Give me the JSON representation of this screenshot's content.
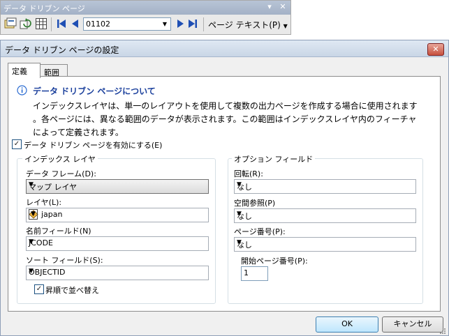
{
  "toolbar": {
    "title": "データ ドリブン ページ",
    "page_value": "01102",
    "page_text_label": "ページ テキスト(P)",
    "icons": [
      "setup-icon",
      "refresh-icon",
      "table-icon",
      "first-page-icon",
      "previous-page-icon",
      "next-page-icon",
      "last-page-icon"
    ]
  },
  "dialog": {
    "title": "データ ドリブン ページの設定",
    "tabs": [
      "定義",
      "範囲"
    ],
    "about_heading": "データ ドリブン ページについて",
    "about_line1": "インデックスレイヤは、単一のレイアウトを使用して複数の出力ページを作成する場合に使用されます",
    "about_line2": "。各ページには、異なる範囲のデータが表示されます。この範囲はインデックスレイヤ内のフィーチャ",
    "about_line3": "によって定義されます。",
    "enable_label": "データ ドリブン ページを有効にする(E)",
    "enable_checked": true,
    "index_group": {
      "title": "インデックス レイヤ",
      "data_frame_label": "データ フレーム(D):",
      "data_frame_value": "マップ レイヤ",
      "layer_label": "レイヤ(L):",
      "layer_value": "japan",
      "name_field_label": "名前フィールド(N)",
      "name_field_value": "JCODE",
      "sort_field_label": "ソート フィールド(S):",
      "sort_field_value": "OBJECTID",
      "ascending_label": "昇順で並べ替え",
      "ascending_checked": true
    },
    "optional_group": {
      "title": "オプション フィールド",
      "rotation_label": "回転(R):",
      "rotation_value": "なし",
      "spatial_ref_label": "空間参照(P)",
      "spatial_ref_value": "なし",
      "page_number_label": "ページ番号(P):",
      "page_number_value": "なし",
      "start_page_label": "開始ページ番号(P):",
      "start_page_value": "1"
    },
    "ok_label": "OK",
    "cancel_label": "キャンセル"
  },
  "colors": {
    "heading_blue": "#1a3f9c",
    "info_icon": "#2a6bd1"
  }
}
